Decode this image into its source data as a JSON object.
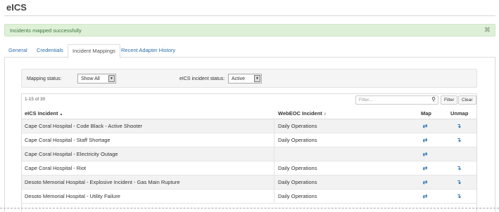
{
  "app": {
    "title": "eICS"
  },
  "alert": {
    "message": "Incidents mapped successfully",
    "close_symbol": "✖"
  },
  "tabs": [
    {
      "label": "General"
    },
    {
      "label": "Credentials"
    },
    {
      "label": "Incident Mappings",
      "active": true
    },
    {
      "label": "Recent Adapter History"
    }
  ],
  "filters": {
    "mapping_status_label": "Mapping status:",
    "mapping_status_value": "Show All",
    "eics_status_label": "eICS incident status:",
    "eics_status_value": "Active"
  },
  "table": {
    "pager": "1-15 of 30",
    "search_placeholder": "Filter...",
    "filter_button": "Filter",
    "clear_button": "Clear",
    "columns": {
      "eics_incident": "eICS Incident",
      "webeoc_incident": "WebEOC Incident",
      "map": "Map",
      "unmap": "Unmap"
    },
    "rows": [
      {
        "eics": "Cape Coral Hospital - Code Black - Active Shooter",
        "webeoc": "Daily Operations",
        "map": true,
        "unmap": true
      },
      {
        "eics": "Cape Coral Hospital - Staff Shortage",
        "webeoc": "Daily Operations",
        "map": true,
        "unmap": true
      },
      {
        "eics": "Cape Coral Hospital - Electricity Outage",
        "webeoc": "",
        "map": true,
        "unmap": false
      },
      {
        "eics": "Cape Coral Hospital - Riot",
        "webeoc": "Daily Operations",
        "map": true,
        "unmap": true
      },
      {
        "eics": "Desoto Memorial Hospital - Explosive Incident - Gas Main Rupture",
        "webeoc": "Daily Operations",
        "map": true,
        "unmap": true
      },
      {
        "eics": "Desoto Memorial Hospital - Utility Failure",
        "webeoc": "Daily Operations",
        "map": true,
        "unmap": true
      }
    ]
  },
  "icons": {
    "map": "refresh-arrows-icon",
    "unmap": "arrow-down-icon",
    "accent_color": "#2a6fb0"
  }
}
